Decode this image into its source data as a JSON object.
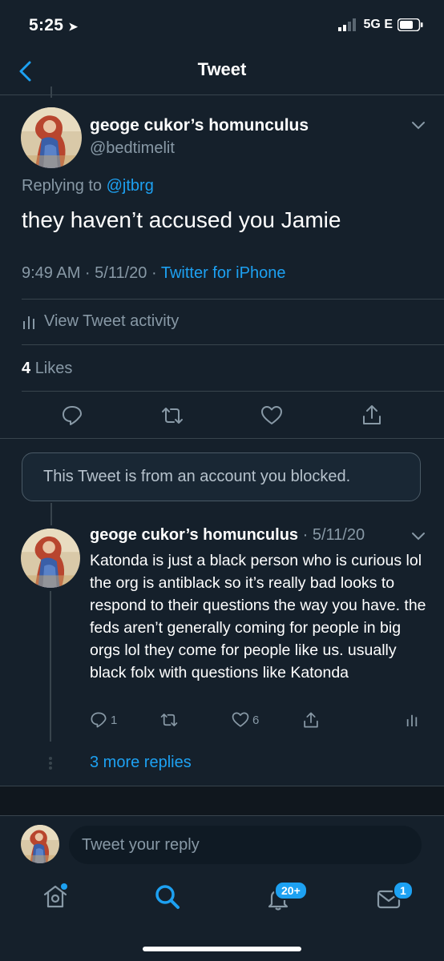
{
  "status_bar": {
    "time": "5:25",
    "network": "5G E"
  },
  "header": {
    "title": "Tweet"
  },
  "main_tweet": {
    "display_name": "geoge cukor’s homunculus",
    "handle": "@bedtimelit",
    "replying_prefix": "Replying to",
    "replying_to": "@jtbrg",
    "text": "they haven’t accused you Jamie",
    "time_date": "9:49 AM · 5/11/20 ·",
    "source": "Twitter for iPhone",
    "view_activity": "View Tweet activity",
    "likes_count": "4",
    "likes_label": "Likes"
  },
  "blocked_notice": "This Tweet is from an account you blocked.",
  "reply_tweet": {
    "display_name": "geoge cukor’s homunculus",
    "date": "· 5/11/20",
    "text": "Katonda is just a black person who is curious lol the org is antiblack so it’s really bad looks to respond to their questions the way you have. the feds aren’t generally coming for people in big orgs lol they come for people like us. usually black folx with questions like Katonda",
    "reply_count": "1",
    "like_count": "6",
    "more_replies": "3 more replies"
  },
  "composer": {
    "placeholder": "Tweet your reply"
  },
  "tab_bar": {
    "notifications_badge": "20+",
    "messages_badge": "1"
  },
  "colors": {
    "background": "#15202b",
    "accent": "#1da1f2",
    "muted": "#8899a6",
    "divider": "#38444d"
  }
}
